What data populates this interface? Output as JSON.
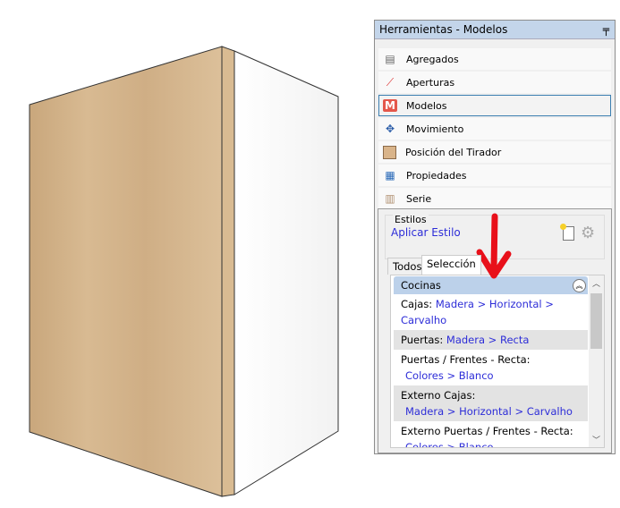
{
  "panel": {
    "title": "Herramientas - Modelos",
    "pin_icon": "pin-icon",
    "items": [
      {
        "label": "Agregados",
        "icon": "agregados-icon"
      },
      {
        "label": "Aperturas",
        "icon": "aperturas-icon"
      },
      {
        "label": "Modelos",
        "icon": "modelos-icon",
        "selected": true
      },
      {
        "label": "Movimiento",
        "icon": "move-icon"
      },
      {
        "label": "Posición del Tirador",
        "icon": "handle-position-icon"
      },
      {
        "label": "Propiedades",
        "icon": "properties-icon"
      },
      {
        "label": "Serie",
        "icon": "series-icon"
      }
    ]
  },
  "estilos": {
    "group_label": "Estilos",
    "apply_link": "Aplicar Estilo"
  },
  "tabs": [
    "Todos",
    "Selección"
  ],
  "list": {
    "header": "Cocinas",
    "rows": [
      {
        "label": "Cajas:",
        "value": "Madera > Horizontal > Carvalho"
      },
      {
        "label": "Puertas:",
        "value": "Madera > Recta"
      },
      {
        "label": "Puertas / Frentes - Recta:",
        "value": "Colores > Blanco"
      },
      {
        "label": "Externo Cajas:",
        "value": "Madera > Horizontal > Carvalho"
      },
      {
        "label": "Externo Puertas / Frentes - Recta:",
        "value": "Colores > Blanco"
      }
    ]
  }
}
